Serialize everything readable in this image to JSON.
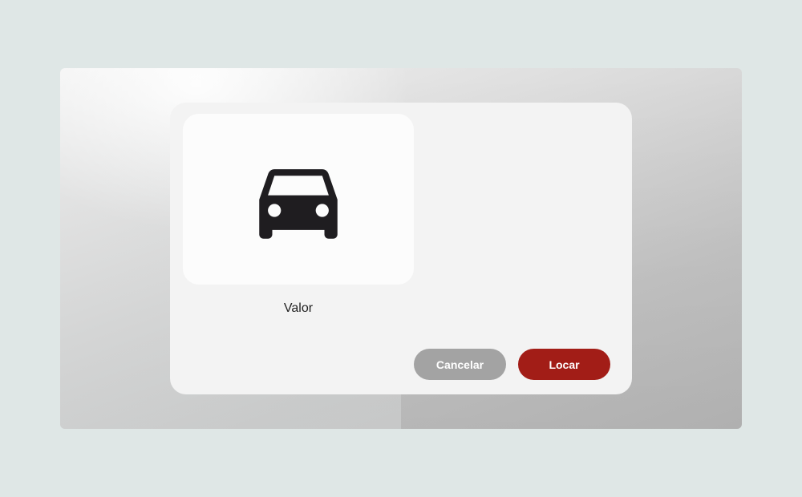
{
  "modal": {
    "image_icon": "car-icon",
    "value_label": "Valor",
    "cancel_label": "Cancelar",
    "rent_label": "Locar"
  },
  "colors": {
    "page_background": "#dfe7e6",
    "modal_background": "#f3f3f3",
    "cancel_button": "#a3a3a3",
    "rent_button": "#a21d17",
    "icon": "#1f1d20"
  }
}
